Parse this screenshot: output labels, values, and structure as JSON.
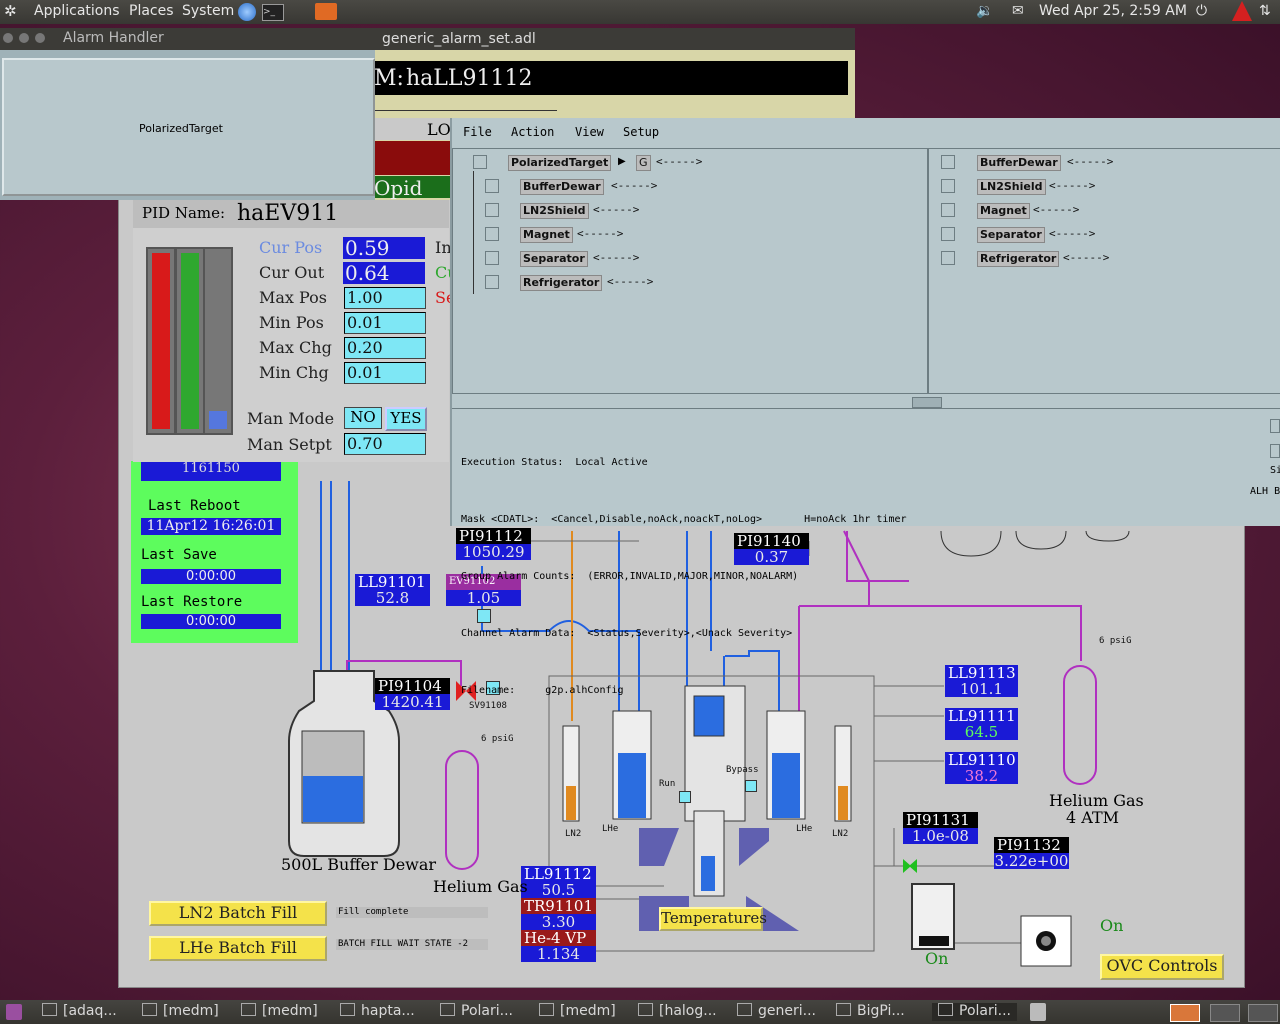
{
  "top_panel": {
    "menus": [
      "Applications",
      "Places",
      "System"
    ],
    "clock": "Wed Apr 25,  2:59 AM"
  },
  "alarm_handler_small": {
    "title": "Alarm Handler",
    "group": "PolarizedTarget"
  },
  "alarm_set_window": {
    "title": "generic_alarm_set.adl",
    "channel_prefix": "M:",
    "channel": "haLL91112",
    "partial_low": "LOW",
    "partial_pid": "Opid"
  },
  "pid_panel": {
    "name_label": "PID Name:",
    "name": "haEV911",
    "rows": [
      {
        "label": "Cur Pos",
        "value": "0.59"
      },
      {
        "label": "Cur Out",
        "value": "0.64"
      },
      {
        "label": "Max Pos",
        "value": "1.00"
      },
      {
        "label": "Min Pos",
        "value": "0.01"
      },
      {
        "label": "Max Chg",
        "value": "0.20"
      },
      {
        "label": "Min Chg",
        "value": "0.01"
      }
    ],
    "man_mode_label": "Man Mode",
    "man_mode_no": "NO",
    "man_mode_yes": "YES",
    "man_setpt_label": "Man Setpt",
    "man_setpt": "0.70",
    "partial_in": "In",
    "partial_cu": "Cu",
    "partial_se": "Se",
    "bar_levels": [
      1.0,
      1.0,
      0.1
    ]
  },
  "alh_window": {
    "menus": [
      "File",
      "Action",
      "View",
      "Setup"
    ],
    "tree": [
      {
        "label": "PolarizedTarget",
        "suffix": "<----->",
        "g": "G"
      },
      {
        "label": "BufferDewar",
        "suffix": "<----->"
      },
      {
        "label": "LN2Shield",
        "suffix": "<----->"
      },
      {
        "label": "Magnet",
        "suffix": "<----->"
      },
      {
        "label": "Separator",
        "suffix": "<----->"
      },
      {
        "label": "Refrigerator",
        "suffix": "<----->"
      }
    ],
    "right_list": [
      {
        "label": "BufferDewar",
        "suffix": "<----->"
      },
      {
        "label": "LN2Shield",
        "suffix": "<----->"
      },
      {
        "label": "Magnet",
        "suffix": "<----->"
      },
      {
        "label": "Separator",
        "suffix": "<----->"
      },
      {
        "label": "Refrigerator",
        "suffix": "<----->"
      }
    ],
    "status": {
      "execution": "Execution Status:  Local Active",
      "mask": "Mask <CDATL>:  <Cancel,Disable,noAck,noackT,noLog>       H=noAck 1hr timer",
      "group_counts": "Group Alarm Counts:  (ERROR,INVALID,MAJOR,MINOR,NOALARM)",
      "channel_data": "Channel Alarm Data:  <Status,Severity>,<Unack Severity>",
      "filename": "Filename:     g2p.alhConfig"
    },
    "edge_si": "Si",
    "edge_alh": "ALH B"
  },
  "left_status": {
    "top_value": "1161150",
    "last_reboot_label": "Last Reboot",
    "last_reboot": "11Apr12 16:26:01",
    "last_save_label": "Last Save",
    "last_save": "0:00:00",
    "last_restore_label": "Last Restore",
    "last_restore": "0:00:00"
  },
  "schematic": {
    "readouts": [
      {
        "tag": "PI91112",
        "value": "1050.29"
      },
      {
        "tag": "PI91140",
        "value": "0.37"
      },
      {
        "tag": "LL91101",
        "value": "52.8"
      },
      {
        "tag": "EV91102",
        "value": "1.05"
      },
      {
        "tag": "PI91104",
        "value": "1420.41"
      },
      {
        "tag": "LL91113",
        "value": "101.1"
      },
      {
        "tag": "LL91111",
        "value": "64.5"
      },
      {
        "tag": "LL91110",
        "value": "38.2"
      },
      {
        "tag": "PI91131",
        "value": "1.0e-08"
      },
      {
        "tag": "PI91132",
        "value": "3.22e+00"
      },
      {
        "tag": "LL91112",
        "value": "50.5"
      },
      {
        "tag": "TR91101",
        "value": "3.30"
      },
      {
        "tag": "He-4 VP",
        "value": "1.134"
      }
    ],
    "labels": {
      "buffer_dewar": "500L Buffer Dewar",
      "helium_gas": "Helium Gas",
      "helium_gas_4atm_1": "Helium Gas",
      "helium_gas_4atm_2": "4 ATM",
      "sv": "SV91108",
      "psig1": "6 psiG",
      "psig2": "6 psiG",
      "ln2_left": "LN2",
      "lhe_left": "LHe",
      "lhe_right": "LHe",
      "ln2_right": "LN2",
      "run": "Run",
      "bypass": "Bypass",
      "on1": "On",
      "on2": "On"
    },
    "buttons": {
      "ln2_batch": "LN2 Batch Fill",
      "lhe_batch": "LHe Batch Fill",
      "temperatures": "Temperatures",
      "ovc": "OVC Controls"
    },
    "ln2_status": "Fill complete",
    "lhe_status": "BATCH FILL WAIT STATE -2"
  },
  "taskbar": [
    "[adaq...",
    "[medm]",
    "[medm]",
    "hapta...",
    "Polari...",
    "[medm]",
    "[halog...",
    "generi...",
    "BigPi...",
    "Polari..."
  ]
}
